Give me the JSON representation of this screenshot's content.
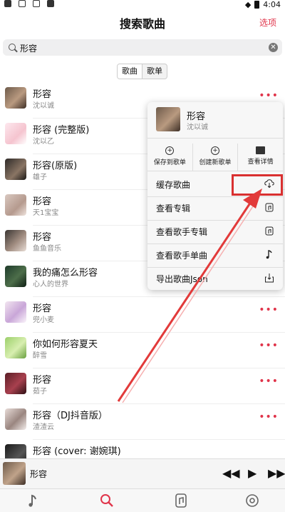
{
  "header": {
    "title": "搜索歌曲",
    "options_label": "选项"
  },
  "status": {
    "time": "4:04"
  },
  "search": {
    "value": "形容"
  },
  "segments": [
    "歌曲",
    "歌单"
  ],
  "songs": [
    {
      "title": "形容",
      "artist": "沈以诚"
    },
    {
      "title": "形容 (完整版)",
      "artist": "沈以乙"
    },
    {
      "title": "形容(原版)",
      "artist": "雄子"
    },
    {
      "title": "形容",
      "artist": "天1宝宝"
    },
    {
      "title": "形容",
      "artist": "鱼鱼音乐"
    },
    {
      "title": "我的痛怎么形容",
      "artist": "心人的世界"
    },
    {
      "title": "形容",
      "artist": "兜小麦"
    },
    {
      "title": "你如何形容夏天",
      "artist": "醉雪"
    },
    {
      "title": "形容",
      "artist": "茹子"
    },
    {
      "title": "形容（DJ抖音版）",
      "artist": "渣渣云"
    },
    {
      "title": "形容 (cover: 谢婉琪)",
      "artist": ""
    }
  ],
  "more_glyph": "•••",
  "popup": {
    "title": "形容",
    "artist": "沈以诚",
    "actions": [
      "保存到歌单",
      "创建新歌单",
      "查看详情"
    ],
    "items": [
      "缓存歌曲",
      "查看专辑",
      "查看歌手专辑",
      "查看歌手单曲",
      "导出歌曲Json"
    ]
  },
  "player": {
    "title": "形容",
    "prev": "◀◀",
    "play": "▶",
    "next": "▶▶"
  },
  "colors": {
    "accent": "#e0344a",
    "highlight": "#d93030"
  }
}
